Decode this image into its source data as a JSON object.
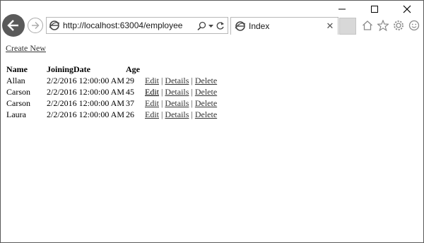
{
  "browser": {
    "url": "http://localhost:63004/employee",
    "tab_title": "Index",
    "tab_close": "✕"
  },
  "page": {
    "create_new": "Create New",
    "headers": [
      "Name",
      "JoiningDate",
      "Age"
    ],
    "rows": [
      {
        "name": "Allan",
        "joining_date": "2/2/2016 12:00:00 AM",
        "age": "29",
        "edit": "Edit",
        "details": "Details",
        "delete": "Delete"
      },
      {
        "name": "Carson",
        "joining_date": "2/2/2016 12:00:00 AM",
        "age": "45",
        "edit": "Edit",
        "details": "Details",
        "delete": "Delete"
      },
      {
        "name": "Carson",
        "joining_date": "2/2/2016 12:00:00 AM",
        "age": "37",
        "edit": "Edit",
        "details": "Details",
        "delete": "Delete"
      },
      {
        "name": "Laura",
        "joining_date": "2/2/2016 12:00:00 AM",
        "age": "26",
        "edit": "Edit",
        "details": "Details",
        "delete": "Delete"
      }
    ],
    "separator": "|"
  },
  "icons": {
    "back": "back-arrow-icon",
    "forward": "forward-arrow-icon",
    "search": "search-icon",
    "dropdown": "dropdown-icon",
    "refresh": "refresh-icon",
    "home": "home-icon",
    "favorites": "star-icon",
    "settings": "gear-icon",
    "feedback": "smiley-icon"
  },
  "colors": {
    "back_button": "#5a5a5a",
    "link": "#333333",
    "new_tab": "#d8d8d8"
  }
}
